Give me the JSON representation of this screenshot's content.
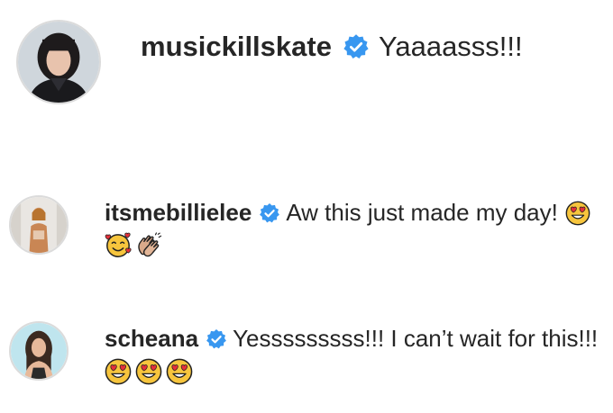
{
  "comments": [
    {
      "username": "musickillskate",
      "verified": true,
      "text": "Yaaaasss!!!",
      "trailing_emoji": [],
      "emoji_line": []
    },
    {
      "username": "itsmebillielee",
      "verified": true,
      "text": "Aw this just made my day!",
      "trailing_emoji": [
        "heart-eyes-emoji"
      ],
      "emoji_line": [
        "smiling-face-with-hearts-emoji",
        "clapping-hands-emoji"
      ]
    },
    {
      "username": "scheana",
      "verified": true,
      "text": "Yesssssssss!!! I can’t wait for this!!!",
      "trailing_emoji": [],
      "emoji_line": [
        "heart-eyes-emoji",
        "heart-eyes-emoji",
        "heart-eyes-emoji"
      ]
    }
  ],
  "colors": {
    "verified_badge": "#3897f0",
    "text": "#262626",
    "avatar_ring": "#dbdbdb",
    "emoji_face": "#f7c53d",
    "emoji_heart": "#e6303a"
  }
}
